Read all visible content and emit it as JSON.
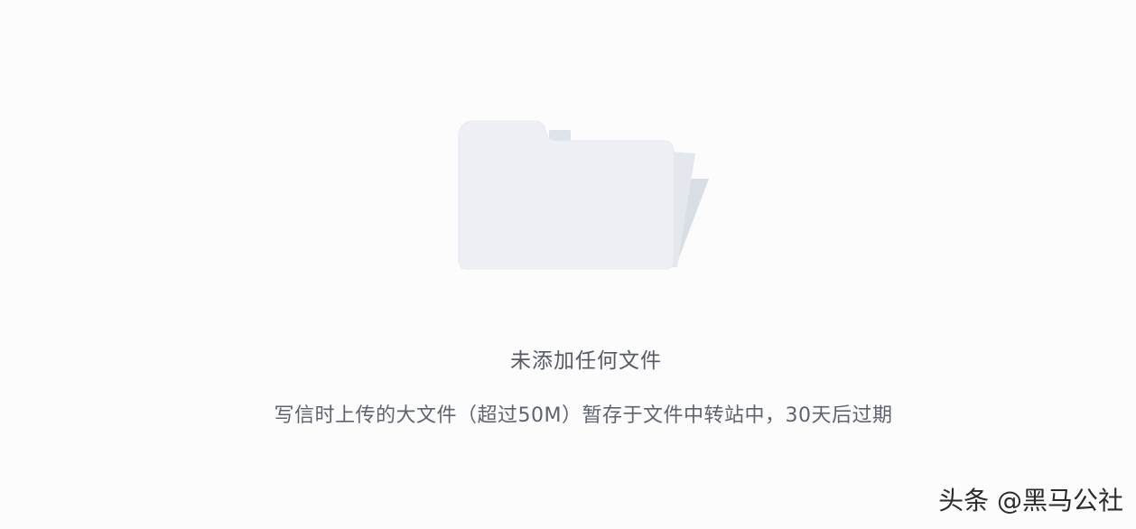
{
  "empty_state": {
    "icon": "folder-icon",
    "title": "未添加任何文件",
    "description": "写信时上传的大文件（超过50M）暂存于文件中转站中，30天后过期"
  },
  "watermark": {
    "text": "头条 @黑马公社"
  },
  "colors": {
    "background": "#fcfcfd",
    "folder_front": "#eef0f5",
    "folder_back": "#d7dbe3",
    "text": "#5d6370"
  }
}
